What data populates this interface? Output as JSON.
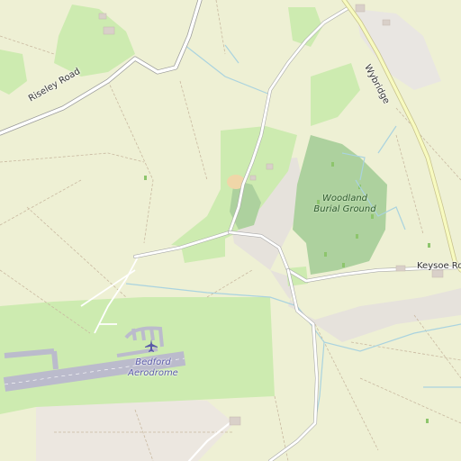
{
  "map": {
    "roads": {
      "riseley": "Riseley Road",
      "wybridge": "Wybridge",
      "keysoe": "Keysoe Row"
    },
    "areas": {
      "woodland_line1": "Woodland",
      "woodland_line2": "Burial Ground",
      "aerodrome_line1": "Bedford",
      "aerodrome_line2": "Aerodrome"
    },
    "colors": {
      "farmland": "#eef0d4",
      "grass": "#cdebb0",
      "wood": "#add19e",
      "residential": "#e0dfdf",
      "water": "#aad3df",
      "road_yellow": "#f7fabf",
      "runway": "#bbbbcc"
    },
    "icons": [
      "airport-icon",
      "tree-icon"
    ]
  }
}
